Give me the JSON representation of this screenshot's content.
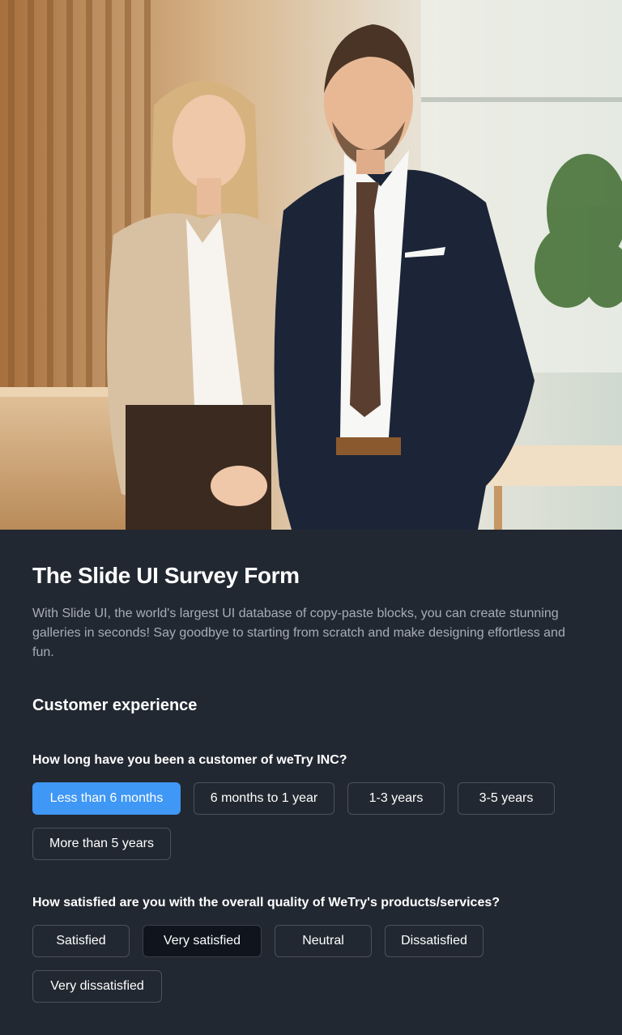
{
  "hero": {
    "image": "business-team-photo"
  },
  "form": {
    "title": "The Slide UI Survey Form",
    "description": "With Slide UI, the world's largest UI database of copy-paste blocks, you can create stunning galleries in seconds! Say goodbye to starting from scratch and make designing effortless and fun.",
    "section_title": "Customer experience",
    "questions": [
      {
        "label": "How long have you been a customer of  weTry INC?",
        "options": [
          "Less than 6 months",
          "6 months to 1 year",
          "1-3 years",
          "3-5 years",
          "More than 5 years"
        ],
        "selected": "Less than 6 months"
      },
      {
        "label": "How satisfied are you with the overall quality of WeTry's products/services?",
        "options": [
          "Satisfied",
          "Very satisfied",
          "Neutral",
          "Dissatisfied",
          "Very dissatisfied"
        ],
        "selected": "Very satisfied"
      }
    ]
  },
  "colors": {
    "background": "#222831",
    "selected_primary": "#3f97f6",
    "selected_dark": "#0f141d",
    "border": "#4b525c",
    "muted_text": "#a7adb6"
  }
}
